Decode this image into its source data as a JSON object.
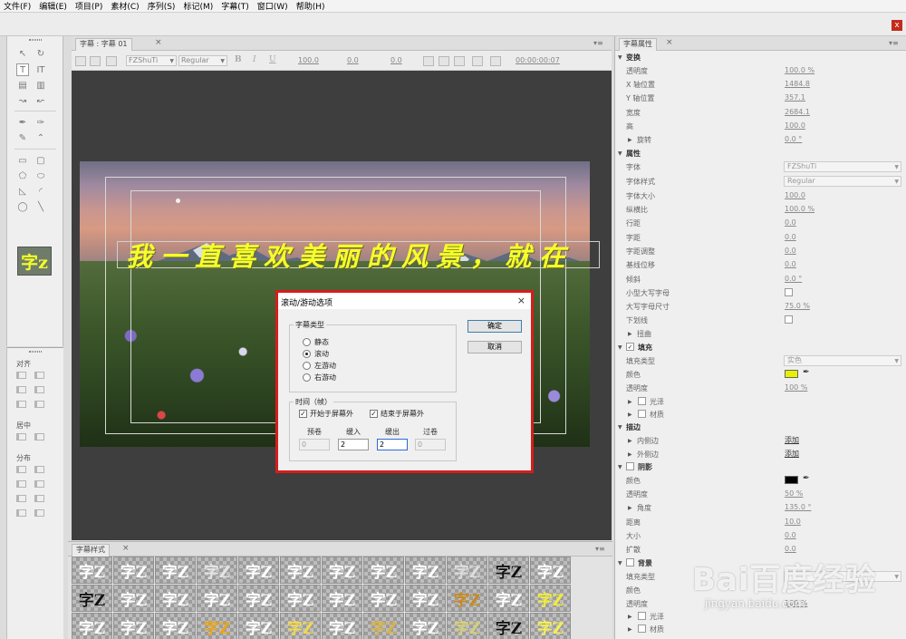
{
  "menu": [
    "文件(F)",
    "编辑(E)",
    "项目(P)",
    "素材(C)",
    "序列(S)",
    "标记(M)",
    "字幕(T)",
    "窗口(W)",
    "帮助(H)"
  ],
  "app_close_glyph": "x",
  "title_panel": {
    "tab_label": "字幕 : 字幕 01",
    "close_glyph": "×",
    "font_family": "FZShuTi",
    "font_style": "Regular",
    "bold_glyph": "B",
    "italic_glyph": "I",
    "underline_glyph": "U",
    "size_value": "100.0",
    "kerning_value": "0.0",
    "leading_value": "0.0",
    "timecode": "00:00:00:07",
    "canvas_text": "我一直喜欢美丽的风景，就在"
  },
  "tools_thumb_text": "字z",
  "align_panel": {
    "align_label": "对齐",
    "center_label": "居中",
    "distribute_label": "分布"
  },
  "styles_panel": {
    "tab_label": "字幕样式",
    "close_glyph": "×",
    "samples": [
      {
        "text": "字Z",
        "color": "#ffffff",
        "bg": ""
      },
      {
        "text": "字Z",
        "color": "#ffffff",
        "bg": ""
      },
      {
        "text": "字Z",
        "color": "#ffffff",
        "bg": ""
      },
      {
        "text": "字Z",
        "color": "#e5e5e5",
        "bg": ""
      },
      {
        "text": "字Z",
        "color": "#ffffff",
        "bg": ""
      },
      {
        "text": "字Z",
        "color": "#ffffff",
        "bg": ""
      },
      {
        "text": "字Z",
        "color": "#ffffff",
        "bg": ""
      },
      {
        "text": "字Z",
        "color": "#ffffff",
        "bg": ""
      },
      {
        "text": "字Z",
        "color": "#ffffff",
        "bg": ""
      },
      {
        "text": "字Z",
        "color": "#dddddd",
        "bg": ""
      },
      {
        "text": "字Z",
        "color": "#111111",
        "bg": ""
      },
      {
        "text": "字Z",
        "color": "#ffffff",
        "bg": ""
      },
      {
        "text": "字Z",
        "color": "#111111",
        "bg": ""
      },
      {
        "text": "字Z",
        "color": "#ffffff",
        "bg": ""
      },
      {
        "text": "字Z",
        "color": "#ffffff",
        "bg": ""
      },
      {
        "text": "字Z",
        "color": "#ffffff",
        "bg": ""
      },
      {
        "text": "字Z",
        "color": "#ffffff",
        "bg": ""
      },
      {
        "text": "字Z",
        "color": "#ffffff",
        "bg": ""
      },
      {
        "text": "字Z",
        "color": "#ffffff",
        "bg": ""
      },
      {
        "text": "字Z",
        "color": "#ffffff",
        "bg": ""
      },
      {
        "text": "字Z",
        "color": "#ffffff",
        "bg": ""
      },
      {
        "text": "字Z",
        "color": "#c8891f",
        "bg": ""
      },
      {
        "text": "字Z",
        "color": "#ffffff",
        "bg": ""
      },
      {
        "text": "字Z",
        "color": "#f2ec3a",
        "bg": ""
      },
      {
        "text": "字Z",
        "color": "#ffffff",
        "bg": ""
      },
      {
        "text": "字Z",
        "color": "#ffffff",
        "bg": ""
      },
      {
        "text": "字Z",
        "color": "#ffffff",
        "bg": ""
      },
      {
        "text": "字Z",
        "color": "#e8a51c",
        "bg": ""
      },
      {
        "text": "字Z",
        "color": "#ffffff",
        "bg": ""
      },
      {
        "text": "字Z",
        "color": "#f3d84e",
        "bg": ""
      },
      {
        "text": "字Z",
        "color": "#ffffff",
        "bg": ""
      },
      {
        "text": "字Z",
        "color": "#d8b24a",
        "bg": ""
      },
      {
        "text": "字Z",
        "color": "#ffffff",
        "bg": ""
      },
      {
        "text": "字Z",
        "color": "#d6cf7a",
        "bg": ""
      },
      {
        "text": "字Z",
        "color": "#111111",
        "bg": ""
      },
      {
        "text": "字Z",
        "color": "#f6f052",
        "bg": ""
      }
    ]
  },
  "properties": {
    "tab_label": "字幕属性",
    "close_glyph": "×",
    "transform_head": "变换",
    "opacity_label": "透明度",
    "opacity_value": "100.0 %",
    "xpos_label": "X 轴位置",
    "xpos_value": "1484.8",
    "ypos_label": "Y 轴位置",
    "ypos_value": "357.1",
    "width_label": "宽度",
    "width_value": "2684.1",
    "height_label": "高",
    "height_value": "100.0",
    "rotation_label": "旋转",
    "rotation_value": "0.0 °",
    "props_head": "属性",
    "font_label": "字体",
    "font_value": "FZShuTi",
    "font_style_label": "字体样式",
    "font_style_value": "Regular",
    "font_size_label": "字体大小",
    "font_size_value": "100.0",
    "aspect_label": "纵横比",
    "aspect_value": "100.0 %",
    "leading_label": "行距",
    "leading_value": "0.0",
    "kerning_label": "字距",
    "kerning_value": "0.0",
    "tracking_label": "字距调整",
    "tracking_value": "0.0",
    "baseline_label": "基线位移",
    "baseline_value": "0.0",
    "slant_label": "倾斜",
    "slant_value": "0.0 °",
    "smallcaps_label": "小型大写字母",
    "smallcaps_size_label": "大写字母尺寸",
    "smallcaps_size_value": "75.0 %",
    "underline_label": "下划线",
    "distort_label": "扭曲",
    "fill_head": "填充",
    "fill_type_label": "填充类型",
    "fill_type_value": "实色",
    "fill_color_label": "颜色",
    "fill_color": "#e8f000",
    "fill_opacity_label": "透明度",
    "fill_opacity_value": "100 %",
    "sheen_label": "光泽",
    "texture_label": "材质",
    "stroke_head": "描边",
    "inner_stroke_label": "内侧边",
    "inner_stroke_value": "添加",
    "outer_stroke_label": "外侧边",
    "outer_stroke_value": "添加",
    "shadow_head": "阴影",
    "shadow_color_label": "颜色",
    "shadow_color": "#000000",
    "shadow_opacity_label": "透明度",
    "shadow_opacity_value": "50 %",
    "angle_label": "角度",
    "angle_value": "135.0 °",
    "distance_label": "距离",
    "distance_value": "10.0",
    "size_label": "大小",
    "size_value": "0.0",
    "spread_label": "扩散",
    "spread_value": "0.0",
    "bg_head": "背景",
    "bg_fill_type_label": "填充类型",
    "bg_color_label": "颜色",
    "bg_opacity_label": "透明度",
    "bg_opacity_value": "100 %",
    "bg_sheen_label": "光泽",
    "bg_texture_label": "材质"
  },
  "dialog": {
    "title": "滚动/游动选项",
    "close_glyph": "×",
    "type_group": "字幕类型",
    "radio_still": "静态",
    "radio_roll": "滚动",
    "radio_crawl_left": "左游动",
    "radio_crawl_right": "右游动",
    "timing_group": "时间（帧）",
    "start_offscreen": "开始于屏幕外",
    "end_offscreen": "结束于屏幕外",
    "preroll_label": "预卷",
    "preroll_value": "0",
    "easein_label": "缓入",
    "easein_value": "2",
    "easeout_label": "缓出",
    "easeout_value": "2",
    "postroll_label": "过卷",
    "postroll_value": "0",
    "ok": "确定",
    "cancel": "取消"
  },
  "watermark": {
    "text": "Bai百度经验",
    "url": "jingyan.baidu.com"
  }
}
